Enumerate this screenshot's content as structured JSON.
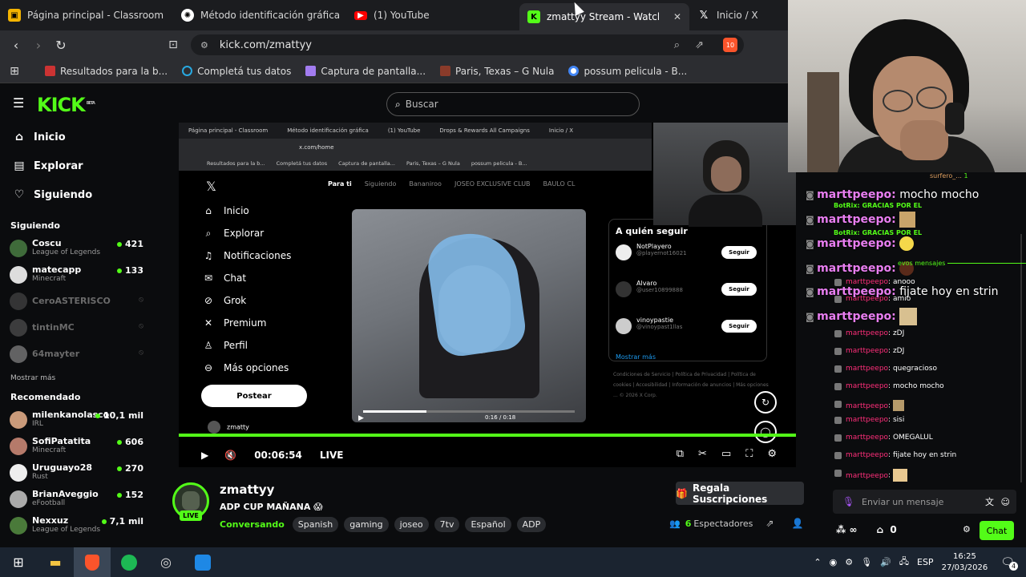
{
  "browser": {
    "tabs": [
      {
        "label": "Página principal - Classroom",
        "color": "#f4b400",
        "icon": "classroom-icon"
      },
      {
        "label": "Método identificación gráfica",
        "color": "#dddddd",
        "icon": "chatgpt-icon"
      },
      {
        "label": "(1) YouTube",
        "color": "#ff0000",
        "icon": "youtube-icon"
      },
      {
        "label": "zmattyy Stream - Watch Live on Kick",
        "color": "#53fc18",
        "icon": "kick-icon"
      },
      {
        "label": "Inicio / X",
        "color": "#ffffff",
        "icon": "x-icon"
      }
    ],
    "url": "kick.com/zmattyy",
    "shield_count": "10",
    "bookmarks": [
      "Resultados para la b...",
      "Completá tus datos",
      "Captura de pantalla...",
      "Paris, Texas – G Nula",
      "possum pelicula - B..."
    ]
  },
  "kick": {
    "logo": "KICK",
    "logo_beta": "BETA",
    "search_placeholder": "Buscar",
    "nav": [
      "Inicio",
      "Explorar",
      "Siguiendo"
    ],
    "following_header": "Siguiendo",
    "following": [
      {
        "name": "Coscu",
        "game": "League of Legends",
        "viewers": "421",
        "live": true
      },
      {
        "name": "matecapp",
        "game": "Minecraft",
        "viewers": "133",
        "live": true
      },
      {
        "name": "CeroASTERISCO",
        "game": "",
        "viewers": "",
        "live": false
      },
      {
        "name": "tintinMC",
        "game": "",
        "viewers": "",
        "live": false
      },
      {
        "name": "64mayter",
        "game": "",
        "viewers": "",
        "live": false
      }
    ],
    "show_more": "Mostrar más",
    "recommended_header": "Recomendado",
    "recommended": [
      {
        "name": "milenkanolasco",
        "game": "IRL",
        "viewers": "10,1 mil"
      },
      {
        "name": "SofiPatatita",
        "game": "Minecraft",
        "viewers": "606"
      },
      {
        "name": "Uruguayo28",
        "game": "Rust",
        "viewers": "270"
      },
      {
        "name": "BrianAveggio",
        "game": "eFootball",
        "viewers": "152"
      },
      {
        "name": "Nexxuz",
        "game": "League of Legends",
        "viewers": "7,1 mil"
      }
    ]
  },
  "video": {
    "inner_tabs": [
      "Página principal - Classroom",
      "Método identificación gráfica",
      "(1) YouTube",
      "Drops & Rewards All Campaigns",
      "Inicio / X"
    ],
    "inner_url": "x.com/home",
    "inner_bookmarks": [
      "Resultados para la b...",
      "Completá tus datos",
      "Captura de pantalla...",
      "Paris, Texas – G Nula",
      "possum pelicula - B..."
    ],
    "x_nav": [
      "Inicio",
      "Explorar",
      "Notificaciones",
      "Chat",
      "Grok",
      "Premium",
      "Perfil",
      "Más opciones"
    ],
    "x_post": "Postear",
    "x_user": "zmatty",
    "x_feed_tabs": [
      "Para ti",
      "Siguiendo",
      "Bananiroo",
      "JOSEO EXCLUSIVE CLUB",
      "BAULO CL"
    ],
    "who_to_follow": "A quién seguir",
    "suggestions": [
      {
        "name": "NotPlayero",
        "handle": "@playernot16021"
      },
      {
        "name": "Alvaro",
        "handle": "@user10899888"
      },
      {
        "name": "vinoypastie",
        "handle": "@vinoypast1llas"
      }
    ],
    "follow_label": "Seguir",
    "show_more": "Mostrar más",
    "footer": "Condiciones de Servicio | Política de Privacidad | Política de cookies | Accesibilidad | Información de anuncios | Más opciones ... © 2026 X Corp.",
    "tweet_time": "0:16 / 0:18",
    "stream_time": "00:06:54",
    "live_label": "LIVE"
  },
  "stream": {
    "username": "zmattyy",
    "title": "ADP CUP MAÑANA 😱",
    "category": "Conversando",
    "tags": [
      "Spanish",
      "gaming",
      "joseo",
      "7tv",
      "Español",
      "ADP"
    ],
    "live_badge": "LIVE",
    "sub_button": "Regala Suscripciones",
    "viewers_count": "6",
    "viewers_label": "Espectadores"
  },
  "overlay": {
    "lines": [
      {
        "user": "marttpeepo:",
        "msg": "mocho mocho"
      },
      {
        "user": "marttpeepo:",
        "msg": ""
      },
      {
        "user": "marttpeepo:",
        "msg": ""
      },
      {
        "user": "marttpeepo:",
        "msg": ""
      },
      {
        "user": "marttpeepo:",
        "msg": "fijate hoy en strin"
      },
      {
        "user": "marttpeepo:",
        "msg": ""
      }
    ],
    "botrix1": "BotRix: GRACIAS POR EL",
    "botrix2": "BotRix: GRACIAS POR EL",
    "surfero": "surfero_...",
    "new_messages": "evos mensajes"
  },
  "chat": {
    "messages": [
      {
        "user": "marttpeepo",
        "msg": ": anooo"
      },
      {
        "user": "marttpeepo",
        "msg": ": amio"
      },
      {
        "user": "marttpeepo",
        "msg": ": zDJ"
      },
      {
        "user": "marttpeepo",
        "msg": ": zDJ"
      },
      {
        "user": "marttpeepo",
        "msg": ": quegracioso"
      },
      {
        "user": "marttpeepo",
        "msg": ": mocho mocho"
      },
      {
        "user": "marttpeepo",
        "msg": ":"
      },
      {
        "user": "marttpeepo",
        "msg": ": sisi"
      },
      {
        "user": "marttpeepo",
        "msg": ": OMEGALUL"
      },
      {
        "user": "marttpeepo",
        "msg": ": fijate hoy en strin"
      },
      {
        "user": "marttpeepo",
        "msg": ":"
      }
    ],
    "input_placeholder": "Enviar un mensaje",
    "send_label": "Chat",
    "points": "0"
  },
  "taskbar": {
    "lang": "ESP",
    "time": "16:25",
    "date": "27/03/2026",
    "notif": "4"
  },
  "colors": {
    "kick_green": "#53fc18",
    "chat_user": "#ff2e7a",
    "overlay_user": "#e87ef0"
  }
}
